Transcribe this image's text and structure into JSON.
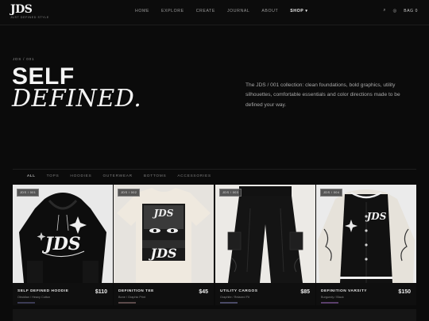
{
  "brand": {
    "logo": "JDS",
    "tagline": "JUST DEFINED STYLE"
  },
  "nav": [
    "HOME",
    "EXPLORE",
    "CREATE",
    "JOURNAL",
    "ABOUT",
    "SHOP"
  ],
  "nav_active": "SHOP",
  "utils": {
    "search": "⌕",
    "account": "◎",
    "bag": "BAG 0"
  },
  "breadcrumb": "JDS / 001",
  "hero": {
    "title_line1": "SELF",
    "title_line2": "DEFINED.",
    "description": "The JDS / 001 collection: clean foundations, bold graphics, utility silhouettes, comfortable essentials and color directions made to be defined your way."
  },
  "filters": [
    "ALL",
    "TOPS",
    "HOODIES",
    "OUTERWEAR",
    "BOTTOMS",
    "ACCESSORIES"
  ],
  "products": [
    {
      "badge": "JDS / 001",
      "name": "SELF DEFINED HOODIE",
      "variant": "Obsidian / Heavy Cotton",
      "price": "$110",
      "swatch": "#3b3b55"
    },
    {
      "badge": "JDS / 002",
      "name": "DEFINITION TEE",
      "variant": "Bone / Graphic Print",
      "price": "$45",
      "swatch": "#5b4a4a"
    },
    {
      "badge": "JDS / 003",
      "name": "UTILITY CARGOS",
      "variant": "Graphite / Relaxed Fit",
      "price": "$85",
      "swatch": "#4a4a66"
    },
    {
      "badge": "JDS / 004",
      "name": "DEFINITION VARSITY",
      "variant": "Burgundy / Black",
      "price": "$150",
      "swatch": "#5a3f6b"
    }
  ]
}
